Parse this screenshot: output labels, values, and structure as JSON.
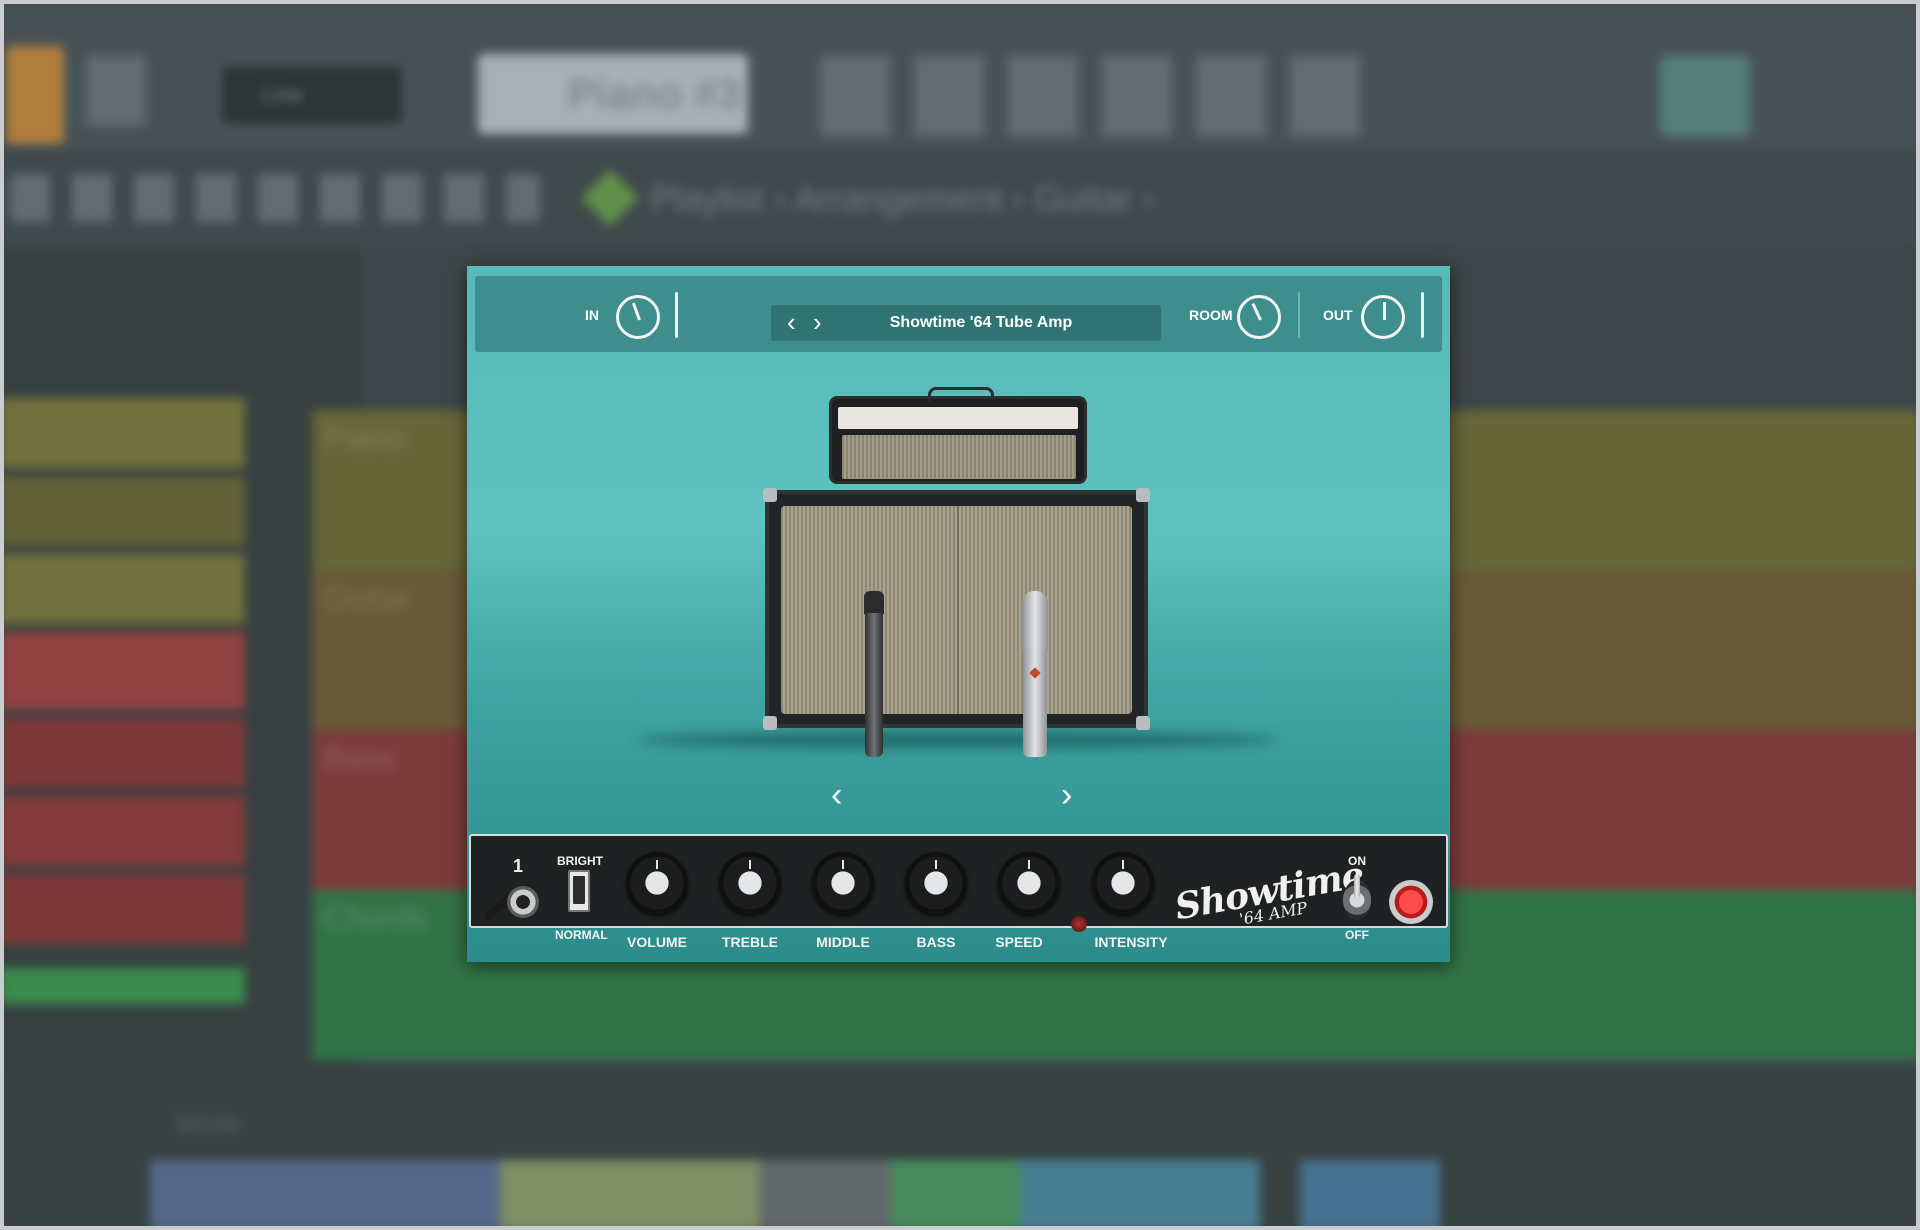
{
  "daw_background": {
    "pattern_name": "Piano #3",
    "preset_dropdown": "Line",
    "breadcrumb": [
      "Playlist",
      "Arrangement",
      "Guitar"
    ],
    "tracks": [
      "Piano",
      "Guitar",
      "Bass",
      "Chords"
    ],
    "bottom_label": "Mode"
  },
  "plugin": {
    "header": {
      "in_label": "IN",
      "preset_name": "Showtime '64 Tube Amp",
      "prev_glyph": "‹",
      "next_glyph": "›",
      "room_label": "ROOM",
      "out_label": "OUT"
    },
    "stage": {
      "prev_arrow": "‹",
      "next_arrow": "›"
    },
    "controls": {
      "channel_number": "1",
      "bright_label": "BRIGHT",
      "normal_label": "NORMAL",
      "knobs": [
        {
          "label": "VOLUME"
        },
        {
          "label": "TREBLE"
        },
        {
          "label": "MIDDLE"
        },
        {
          "label": "BASS"
        },
        {
          "label": "SPEED"
        },
        {
          "label": "INTENSITY"
        }
      ],
      "brand_line1": "Showtime",
      "brand_line2": "'64 AMP",
      "on_label": "ON",
      "off_label": "OFF"
    }
  },
  "colors": {
    "plugin_bg": "#5dc2c0",
    "header_bg": "#3d8e8d",
    "panel_bg": "#1f2223",
    "power_red": "#ff4b4b"
  }
}
